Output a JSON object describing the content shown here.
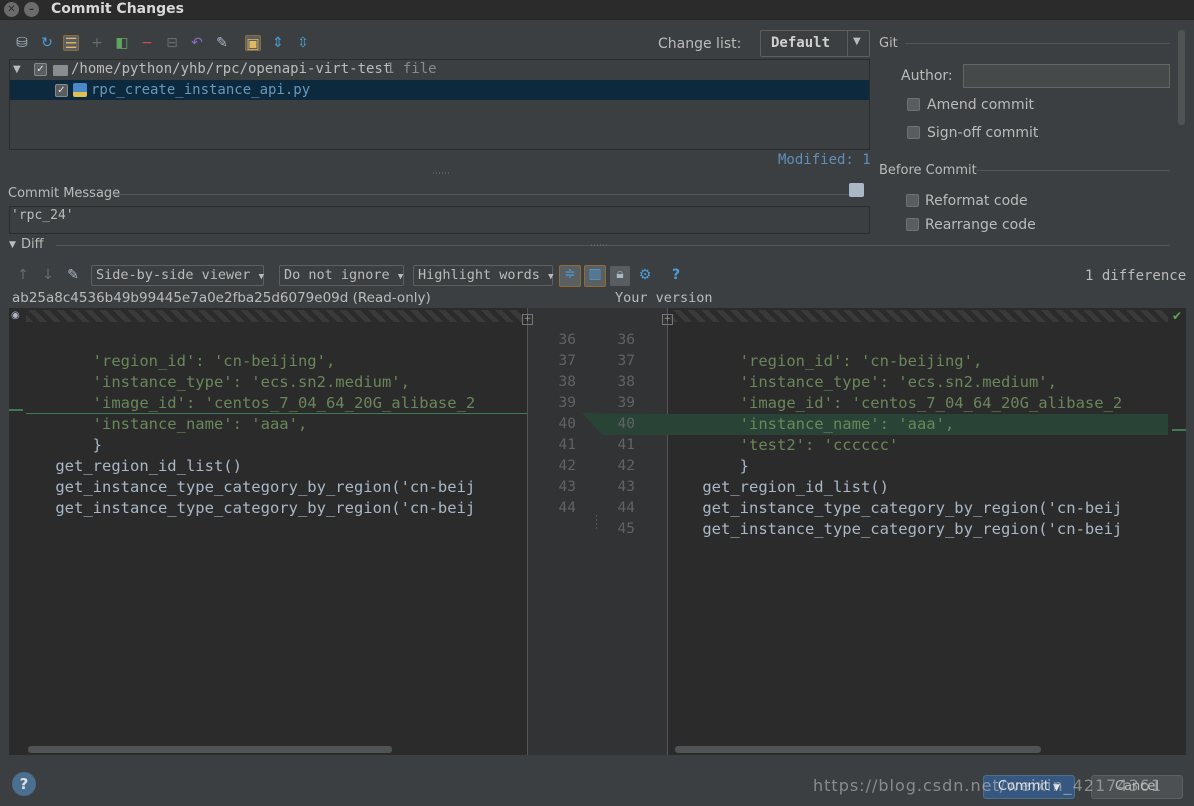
{
  "window": {
    "title": "Commit Changes"
  },
  "toolbar": {
    "icons": [
      "shelf-icon",
      "refresh-icon",
      "group-icon",
      "add-icon",
      "vcs-icon",
      "remove-icon",
      "diff-icon",
      "revert-icon",
      "edit-icon",
      "folder-icon",
      "expand-icon",
      "collapse-icon"
    ],
    "change_list_label": "Change list:",
    "change_list_value": "Default"
  },
  "changes": {
    "root_path": "/home/python/yhb/rpc/openapi-virt-test",
    "root_count": "1 file",
    "file_name": "rpc_create_instance_api.py",
    "modified_label": "Modified: 1"
  },
  "commit_message": {
    "label": "Commit Message",
    "value": "'rpc_24'"
  },
  "git": {
    "section": "Git",
    "author_label": "Author:",
    "author_value": "",
    "amend": "Amend commit",
    "signoff": "Sign-off commit",
    "before_commit": "Before Commit",
    "reformat": "Reformat code",
    "rearrange": "Rearrange code"
  },
  "diff": {
    "section": "Diff",
    "viewer": "Side-by-side viewer",
    "ignore": "Do not ignore",
    "highlight": "Highlight words",
    "differences": "1 difference",
    "left_title": "ab25a8c4536b49b99445e7a0e2fba25d6079e09d (Read-only)",
    "right_title": "Your version",
    "left_lines": [
      "'region_id': 'cn-beijing',",
      "'instance_type': 'ecs.sn2.medium',",
      "'image_id': 'centos_7_04_64_20G_alibase_2",
      "'instance_name': 'aaa',",
      "}",
      "get_region_id_list()",
      "get_instance_type_category_by_region('cn-beij",
      "get_instance_type_category_by_region('cn-beij"
    ],
    "right_lines": [
      "'region_id': 'cn-beijing',",
      "'instance_type': 'ecs.sn2.medium',",
      "'image_id': 'centos_7_04_64_20G_alibase_2",
      "'instance_name': 'aaa',",
      "'test2': 'cccccc'",
      "}",
      "get_region_id_list()",
      "get_instance_type_category_by_region('cn-beij",
      "get_instance_type_category_by_region('cn-beij"
    ],
    "left_nums": [
      "36",
      "37",
      "38",
      "39",
      "40",
      "41",
      "42",
      "43",
      "44"
    ],
    "right_nums": [
      "36",
      "37",
      "38",
      "39",
      "40",
      "41",
      "42",
      "43",
      "44",
      "45"
    ]
  },
  "footer": {
    "commit": "Commit",
    "cancel": "Cancel",
    "help": "?"
  },
  "watermark": "https://blog.csdn.net/weixin_42174361",
  "colors": {
    "string": "#6a8759",
    "code": "#a9b7c6",
    "added": "#294436",
    "selection": "#0d293e",
    "primary": "#365880"
  }
}
